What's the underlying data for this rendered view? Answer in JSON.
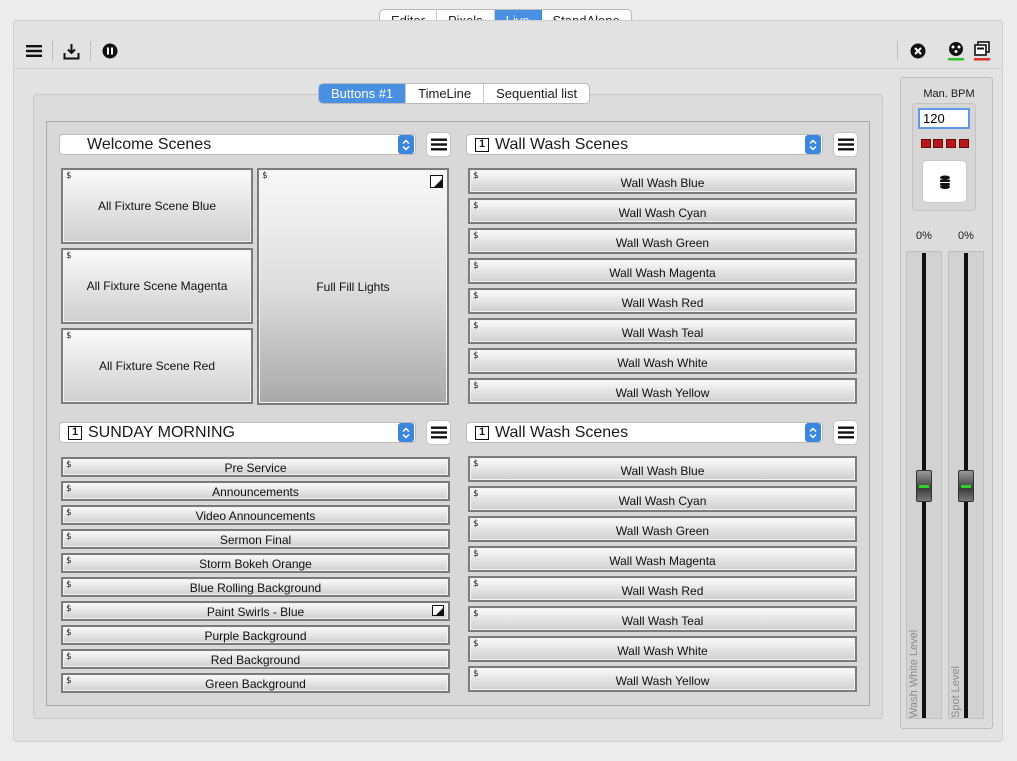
{
  "mode_tabs": [
    "Editor",
    "Pixels",
    "Live",
    "StandAlone"
  ],
  "mode_active": "Live",
  "toolbar": {
    "left_icons": [
      "menu-icon",
      "export-icon",
      "pause-icon"
    ],
    "right_icons": [
      "close-icon",
      "dmx-icon",
      "windows-icon"
    ],
    "accent_green": "#2fbf2f",
    "accent_red": "#e03030"
  },
  "sub_tabs": [
    "Buttons #1",
    "TimeLine",
    "Sequential list"
  ],
  "sub_active": "Buttons #1",
  "sections": {
    "top_left": {
      "title": "Welcome Scenes",
      "number": "",
      "buttons": [
        "All Fixture Scene Blue",
        "All Fixture Scene Magenta",
        "All Fixture Scene Red"
      ],
      "big_button": "Full Fill Lights"
    },
    "top_right": {
      "title": "Wall Wash Scenes",
      "number": "1",
      "buttons": [
        "Wall Wash Blue",
        "Wall Wash Cyan",
        "Wall Wash Green",
        "Wall Wash Magenta",
        "Wall Wash Red",
        "Wall Wash Teal",
        "Wall Wash White",
        "Wall Wash Yellow"
      ]
    },
    "bottom_left": {
      "title": "SUNDAY MORNING",
      "number": "1",
      "buttons": [
        "Pre Service",
        "Announcements",
        "Video Announcements",
        "Sermon Final",
        "Storm Bokeh Orange",
        "Blue Rolling Background",
        "Paint Swirls - Blue",
        "Purple Background",
        "Red Background",
        "Green Background"
      ]
    },
    "bottom_right": {
      "title": "Wall Wash Scenes",
      "number": "1",
      "buttons": [
        "Wall Wash Blue",
        "Wall Wash Cyan",
        "Wall Wash Green",
        "Wall Wash Magenta",
        "Wall Wash Red",
        "Wall Wash Teal",
        "Wall Wash White",
        "Wall Wash Yellow"
      ]
    }
  },
  "dollar_marker": "$",
  "bpm": {
    "title": "Man. BPM",
    "value": "120",
    "tap_icon": "tap-tempo-icon"
  },
  "faders": [
    {
      "label": "Wash White Level",
      "percent": "0%",
      "level": 0.5
    },
    {
      "label": "Spot Level",
      "percent": "0%",
      "level": 0.5
    }
  ]
}
